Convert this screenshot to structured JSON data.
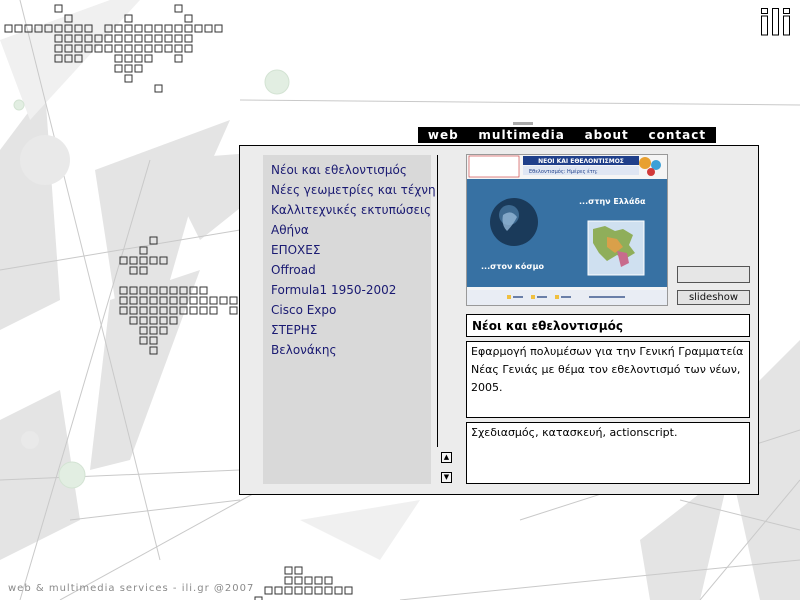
{
  "nav": {
    "items": [
      "web",
      "multimedia",
      "about",
      "contact"
    ]
  },
  "menu": {
    "items": [
      "Νέοι και εθελοντισμός",
      "Νέες γεωμετρίες και τέχνη",
      "Καλλιτεχνικές εκτυπώσεις",
      "Αθήνα",
      "ΕΠΟΧΕΣ",
      "Offroad",
      "Formula1 1950-2002",
      "Cisco Expo",
      "ΣΤΕΡΗΣ",
      "Βελονάκης"
    ]
  },
  "preview": {
    "banner": "ΝΕΟΙ ΚΑΙ ΕΘΕΛΟΝΤΙΣΜΟΣ",
    "subtitle": "Εθελοντισμός: Ημέρες έτη;",
    "caption_greece": "...στην Ελλάδα",
    "caption_world": "...στον κόσμο"
  },
  "controls": {
    "slideshow_label": "slideshow"
  },
  "detail": {
    "title": "Νέοι και εθελοντισμός",
    "description": "Εφαρμογή πολυμέσων για την Γενική Γραμματεία Νέας Γενιάς με θέμα τον εθελοντισμό των νέων, 2005.",
    "credits": "Σχεδιασμός, κατασκευή, actionscript."
  },
  "footer": {
    "text": "web & multimedia services - ili.gr @2007"
  },
  "colors": {
    "menu_text": "#1a1a72",
    "nav_bar": "#000000",
    "panel": "#ececec",
    "menu_bg": "#d9d9d9"
  }
}
